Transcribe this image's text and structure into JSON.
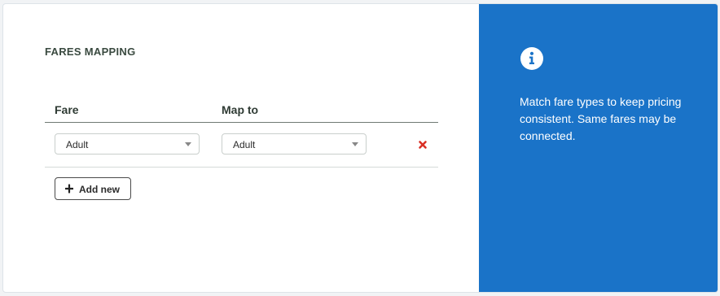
{
  "section": {
    "title": "FARES MAPPING"
  },
  "table": {
    "columns": [
      "Fare",
      "Map to"
    ],
    "rows": [
      {
        "fare": "Adult",
        "map_to": "Adult"
      }
    ]
  },
  "actions": {
    "add_new_label": "Add new"
  },
  "info": {
    "text": "Match fare types to keep pricing consistent. Same fares may be connected."
  },
  "icons": {
    "delete": "close-icon",
    "add": "plus-icon",
    "info": "info-icon",
    "dropdown": "chevron-down-icon"
  },
  "colors": {
    "panel_bg": "#1a73c8",
    "delete_red": "#d93025",
    "title_text": "#3a4a40"
  }
}
